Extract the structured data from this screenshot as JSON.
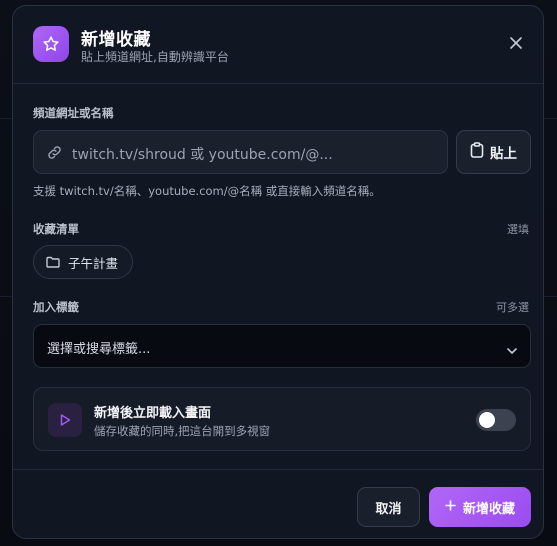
{
  "header": {
    "title": "新增收藏",
    "subtitle": "貼上頻道網址,自動辨識平台"
  },
  "channel": {
    "label": "頻道網址或名稱",
    "placeholder": "twitch.tv/shroud 或 youtube.com/@...",
    "paste_label": "貼上",
    "support_text": "支援 twitch.tv/名稱、youtube.com/@名稱 或直接輸入頻道名稱。"
  },
  "collection": {
    "label": "收藏清單",
    "hint": "選填",
    "chip_label": "子午計畫"
  },
  "tags": {
    "label": "加入標籤",
    "hint": "可多選",
    "placeholder": "選擇或搜尋標籤..."
  },
  "option": {
    "title": "新增後立即載入畫面",
    "description": "儲存收藏的同時,把這台開到多視窗",
    "enabled": false
  },
  "footer": {
    "cancel_label": "取消",
    "add_label": "新增收藏"
  },
  "colors": {
    "accent": "#a259f4",
    "background": "#111722"
  },
  "icons": [
    "star-icon",
    "close-icon",
    "link-icon",
    "clipboard-icon",
    "folder-icon",
    "chevron-down-icon",
    "play-icon",
    "plus-icon"
  ]
}
